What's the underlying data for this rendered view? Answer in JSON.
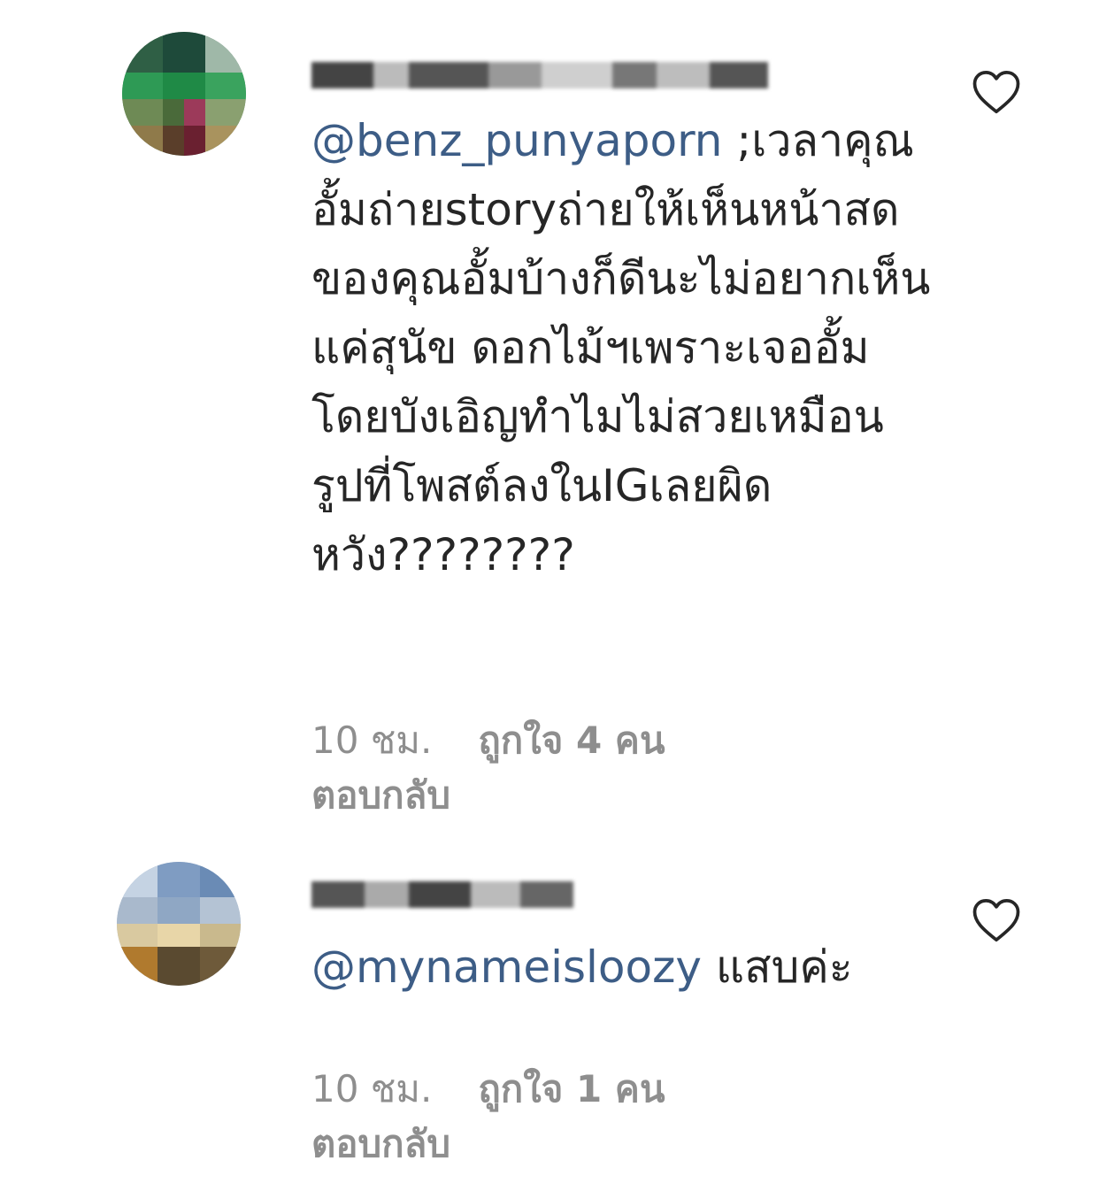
{
  "comments": [
    {
      "mention": "@benz_punyaporn",
      "text": " ;เวลาคุณอั้มถ่ายstoryถ่ายให้เห็นหน้าสดของคุณอั้มบ้างก็ดีนะไม่อยากเห็นแค่สุนัข ดอกไม้ฯเพราะเจออั้มโดยบังเอิญทำไมไม่สวยเหมือนรูปที่โพสต์ลงในIGเลยผิดหวัง????????",
      "time": "10 ชม.",
      "likes": "ถูกใจ 4 คน",
      "reply": "ตอบกลับ",
      "like_icon": "heart-outline-icon"
    },
    {
      "mention": "@mynameisloozy",
      "text": " แสบค่ะ",
      "time": "10 ชม.",
      "likes": "ถูกใจ 1 คน",
      "reply": "ตอบกลับ",
      "like_icon": "heart-outline-icon"
    }
  ],
  "colors": {
    "mention": "#3d5d86",
    "text": "#262626",
    "meta": "#8e8e8e"
  }
}
